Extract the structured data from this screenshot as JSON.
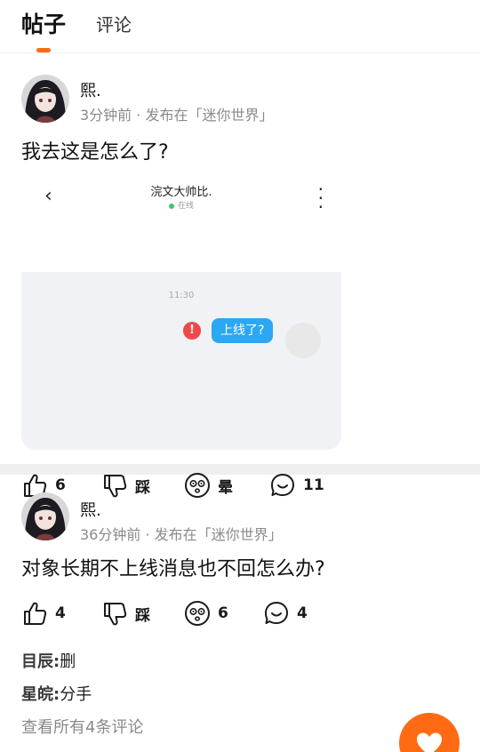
{
  "tabs": [
    {
      "label": "帖子",
      "active": true
    },
    {
      "label": "评论",
      "active": false
    }
  ],
  "colors": {
    "accent": "#ff6a13",
    "bubble": "#2ba7f4",
    "error": "#f04848"
  },
  "posts": [
    {
      "author": "熙.",
      "meta": "3分钟前 · 发布在「迷你世界」",
      "title": "我去这是怎么了?",
      "screenshot": {
        "contact_name": "浣文大帅比.",
        "status": "在线",
        "time": "11:30",
        "error_mark": "!",
        "message": "上线了?"
      },
      "actions": {
        "like": "6",
        "dislike": "踩",
        "dizzy": "晕",
        "comment": "11"
      }
    },
    {
      "author": "熙.",
      "meta": "36分钟前 · 发布在「迷你世界」",
      "title": "对象长期不上线消息也不回怎么办?",
      "actions": {
        "like": "4",
        "dislike": "踩",
        "dizzy": "6",
        "comment": "4"
      },
      "comments": [
        {
          "user": "目辰:",
          "text": "删"
        },
        {
          "user": "星皖:",
          "text": "分手"
        }
      ],
      "view_all": "查看所有4条评论"
    }
  ],
  "icons": {
    "like": "thumbs-up-icon",
    "dislike": "thumbs-down-icon",
    "dizzy": "dizzy-face-icon",
    "comment": "comment-bubble-icon",
    "fab": "heart-icon"
  }
}
